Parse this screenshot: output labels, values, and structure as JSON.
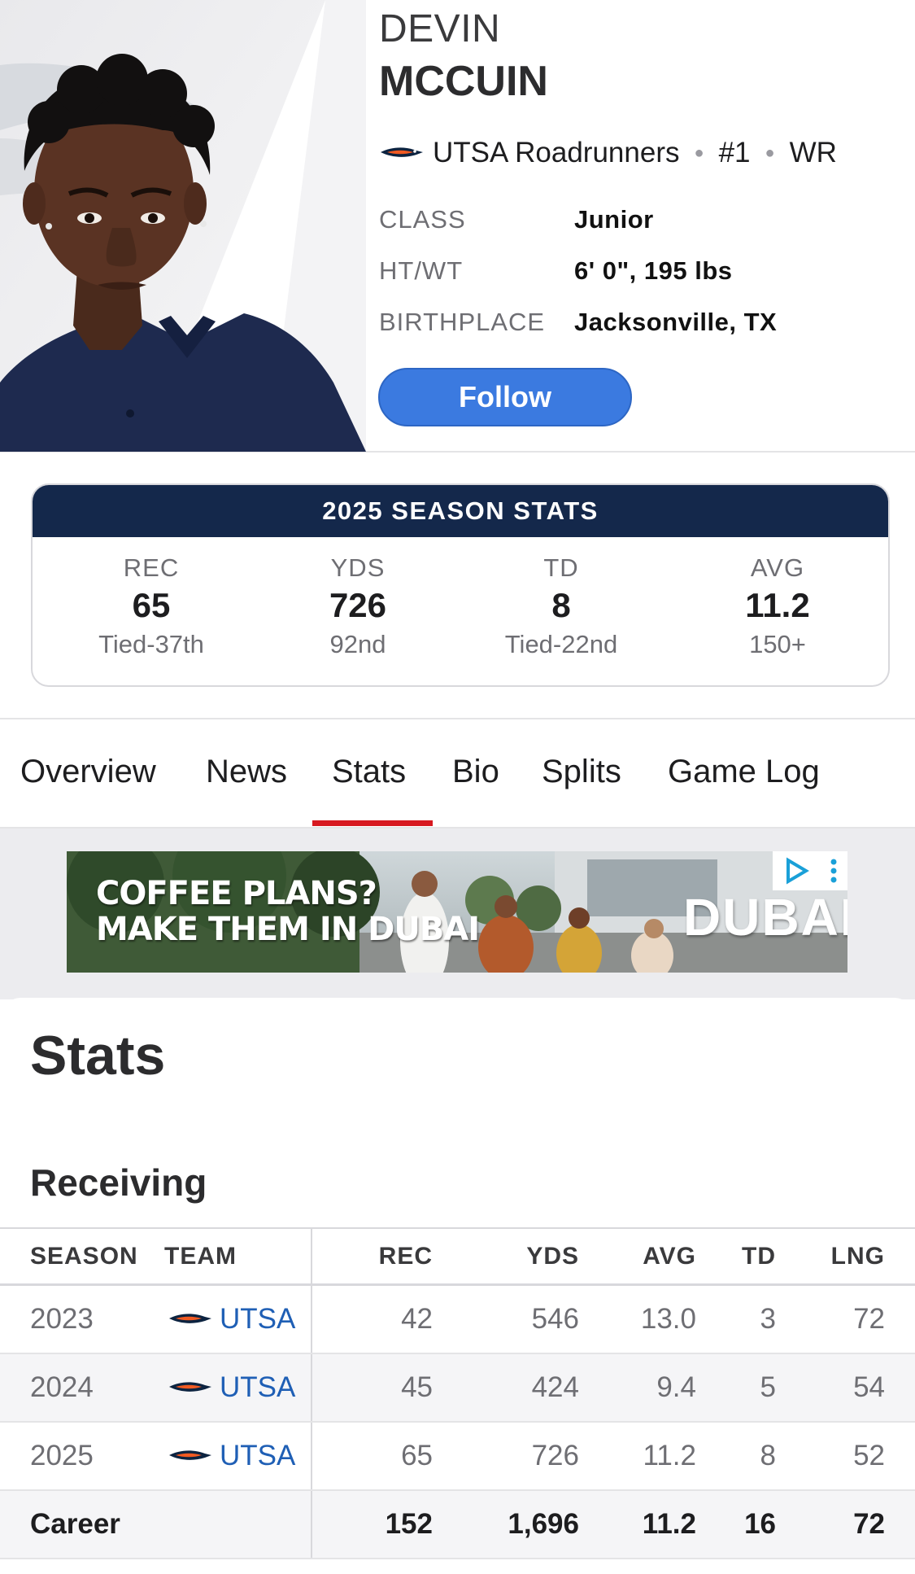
{
  "player": {
    "first_name": "DEVIN",
    "last_name": "MCCUIN",
    "team": "UTSA Roadrunners",
    "number": "#1",
    "position": "WR",
    "follow_label": "Follow",
    "info": [
      {
        "label": "CLASS",
        "value": "Junior"
      },
      {
        "label": "HT/WT",
        "value": "6' 0\", 195 lbs"
      },
      {
        "label": "BIRTHPLACE",
        "value": "Jacksonville, TX"
      }
    ]
  },
  "season_stats": {
    "title": "2025 SEASON STATS",
    "stats": [
      {
        "label": "REC",
        "value": "65",
        "rank": "Tied-37th"
      },
      {
        "label": "YDS",
        "value": "726",
        "rank": "92nd"
      },
      {
        "label": "TD",
        "value": "8",
        "rank": "Tied-22nd"
      },
      {
        "label": "AVG",
        "value": "11.2",
        "rank": "150+"
      }
    ]
  },
  "tabs": {
    "items": [
      "Overview",
      "News",
      "Stats",
      "Bio",
      "Splits",
      "Game Log"
    ],
    "active": "Stats"
  },
  "ad": {
    "line1": "COFFEE PLANS?",
    "line2": "MAKE THEM IN DUBAI",
    "brand": "DUBAI"
  },
  "stats_page": {
    "title": "Stats",
    "section": "Receiving",
    "columns": [
      "SEASON",
      "TEAM",
      "REC",
      "YDS",
      "AVG",
      "TD",
      "LNG"
    ],
    "rows": [
      {
        "season": "2023",
        "team": "UTSA",
        "rec": "42",
        "yds": "546",
        "avg": "13.0",
        "td": "3",
        "lng": "72"
      },
      {
        "season": "2024",
        "team": "UTSA",
        "rec": "45",
        "yds": "424",
        "avg": "9.4",
        "td": "5",
        "lng": "54"
      },
      {
        "season": "2025",
        "team": "UTSA",
        "rec": "65",
        "yds": "726",
        "avg": "11.2",
        "td": "8",
        "lng": "52"
      }
    ],
    "career": {
      "label": "Career",
      "rec": "152",
      "yds": "1,696",
      "avg": "11.2",
      "td": "16",
      "lng": "72"
    }
  },
  "colors": {
    "accent_blue": "#3b7ae0",
    "navy": "#14284b",
    "tab_active": "#d71920",
    "team_link": "#1f5fb5"
  }
}
